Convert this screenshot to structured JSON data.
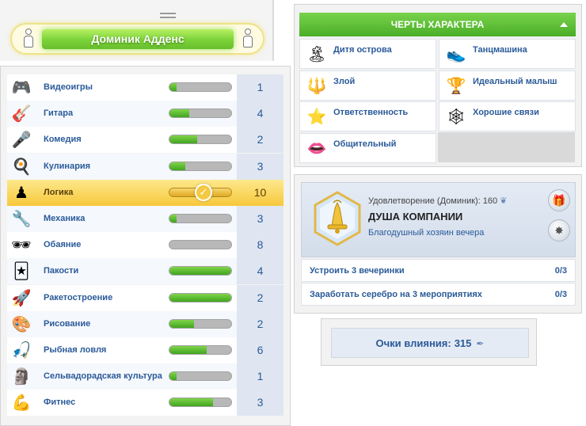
{
  "sim": {
    "name": "Доминик Адденс"
  },
  "skills": [
    {
      "label": "Видеоигры",
      "level": "1",
      "progress": 0.12,
      "icon": "gamepad-icon",
      "glyph": "🎮"
    },
    {
      "label": "Гитара",
      "level": "4",
      "progress": 0.32,
      "icon": "guitar-icon",
      "glyph": "🎸"
    },
    {
      "label": "Комедия",
      "level": "2",
      "progress": 0.45,
      "icon": "microphone-icon",
      "glyph": "🎤"
    },
    {
      "label": "Кулинария",
      "level": "3",
      "progress": 0.25,
      "icon": "frying-pan-icon",
      "glyph": "🍳"
    },
    {
      "label": "Логика",
      "level": "10",
      "progress": 1.0,
      "icon": "chess-pawn-icon",
      "glyph": "♟",
      "selected": true
    },
    {
      "label": "Механика",
      "level": "3",
      "progress": 0.12,
      "icon": "wrench-icon",
      "glyph": "🔧"
    },
    {
      "label": "Обаяние",
      "level": "8",
      "progress": 0.0,
      "icon": "sunglasses-icon",
      "glyph": "🕶"
    },
    {
      "label": "Пакости",
      "level": "4",
      "progress": 1.0,
      "icon": "jester-icon",
      "glyph": "🃏"
    },
    {
      "label": "Ракетостроение",
      "level": "2",
      "progress": 1.0,
      "icon": "rocket-icon",
      "glyph": "🚀"
    },
    {
      "label": "Рисование",
      "level": "2",
      "progress": 0.4,
      "icon": "palette-icon",
      "glyph": "🎨"
    },
    {
      "label": "Рыбная ловля",
      "level": "6",
      "progress": 0.6,
      "icon": "fishing-icon",
      "glyph": "🎣"
    },
    {
      "label": "Сельвадорадская культура",
      "level": "1",
      "progress": 0.12,
      "icon": "tiki-mask-icon",
      "glyph": "🗿"
    },
    {
      "label": "Фитнес",
      "level": "3",
      "progress": 0.7,
      "icon": "muscle-icon",
      "glyph": "💪"
    }
  ],
  "traits": {
    "title": "ЧЕРТЫ ХАРАКТЕРА",
    "items": [
      {
        "label": "Дитя острова",
        "icon": "island-icon",
        "glyph": "🏝"
      },
      {
        "label": "Танцмашина",
        "icon": "sneaker-icon",
        "glyph": "👟"
      },
      {
        "label": "Злой",
        "icon": "pitchfork-icon",
        "glyph": "🔱"
      },
      {
        "label": "Идеальный малыш",
        "icon": "trophy-icon",
        "glyph": "🏆"
      },
      {
        "label": "Ответственность",
        "icon": "star-icon",
        "glyph": "⭐"
      },
      {
        "label": "Хорошие связи",
        "icon": "web-icon",
        "glyph": "🕸"
      },
      {
        "label": "Общительный",
        "icon": "lips-icon",
        "glyph": "👄"
      }
    ]
  },
  "aspiration": {
    "satisfaction": "Удовлетворение (Доминик): 160",
    "title": "ДУША КОМПАНИИ",
    "subtitle": "Благодушный хозяин вечера",
    "tasks": [
      {
        "text": "Устроить 3 вечеринки",
        "progress": "0/3"
      },
      {
        "text": "Заработать серебро на 3 мероприятиях",
        "progress": "0/3"
      }
    ]
  },
  "influence": {
    "label": "Очки влияния:",
    "value": "315"
  },
  "colors": {
    "accent_green": "#4aae27",
    "text_blue": "#2a5a99",
    "gold": "#f7c83b"
  }
}
